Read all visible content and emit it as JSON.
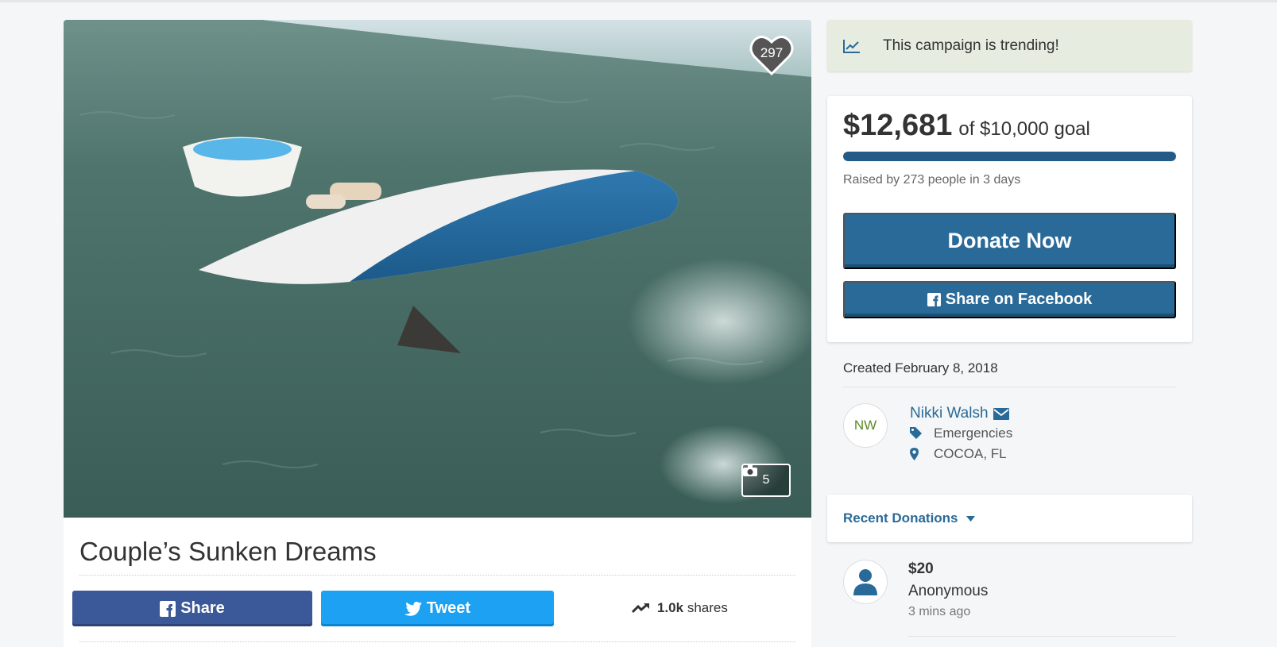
{
  "hero": {
    "likes": "297",
    "photo_count": "5"
  },
  "campaign": {
    "title": "Couple’s Sunken Dreams"
  },
  "share_bar": {
    "facebook_label": "Share",
    "twitter_label": "Tweet",
    "shares_count": "1.0k",
    "shares_suffix": "shares"
  },
  "trending": {
    "text": "This campaign is trending!"
  },
  "donate_card": {
    "raised": "$12,681",
    "goal_text": "of $10,000 goal",
    "progress_fraction": 1.0,
    "raised_by": "Raised by 273 people in 3 days",
    "donate_label": "Donate Now",
    "fb_share_label": "Share on Facebook"
  },
  "details": {
    "created": "Created February 8, 2018",
    "organizer_initials": "NW",
    "organizer_name": "Nikki Walsh",
    "category": "Emergencies",
    "location": "COCOA, FL"
  },
  "recent_donations": {
    "label": "Recent Donations",
    "items": [
      {
        "amount": "$20",
        "name": "Anonymous",
        "time": "3 mins ago"
      }
    ]
  },
  "colors": {
    "primary": "#2a6a98",
    "facebook": "#3b5998",
    "twitter": "#1da1f2",
    "trending_bg": "#e6ecdf",
    "organizer_initials": "#5a8a26"
  }
}
